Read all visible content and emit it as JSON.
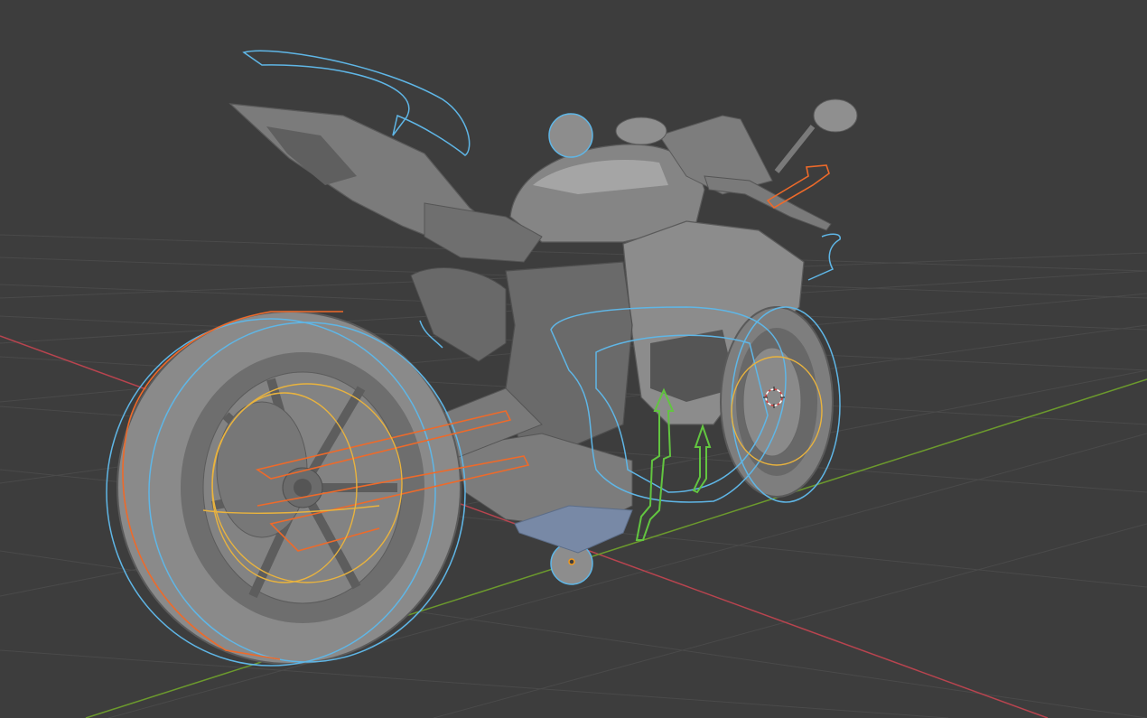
{
  "app": {
    "name": "3D Viewport",
    "view": "perspective"
  },
  "theme": {
    "background": "#3d3d3d",
    "grid_line": "#4a4a4a",
    "axis_x": "#b8444f",
    "axis_y": "#6c9a2d",
    "mesh_fill": "#8a8a8a",
    "mesh_dark": "#5f5f5f",
    "mesh_light": "#a8a8a8",
    "outline_blue": "#5fb6e6",
    "outline_orange": "#ee6a2a",
    "outline_yellow": "#e9b33e",
    "outline_green": "#62c540",
    "cursor_red": "#d63a3a",
    "origin_orange": "#f59a1b"
  },
  "scene": {
    "model": "motorcycle",
    "objects": [
      {
        "name": "rear-wheel",
        "selected": true
      },
      {
        "name": "front-wheel",
        "selected": true
      },
      {
        "name": "body",
        "selected": false
      },
      {
        "name": "controls",
        "selected": true
      },
      {
        "name": "empties",
        "selected": true
      }
    ],
    "icons": [
      "3d-cursor-icon",
      "origin-point-icon",
      "sphere-empty-icon"
    ]
  }
}
